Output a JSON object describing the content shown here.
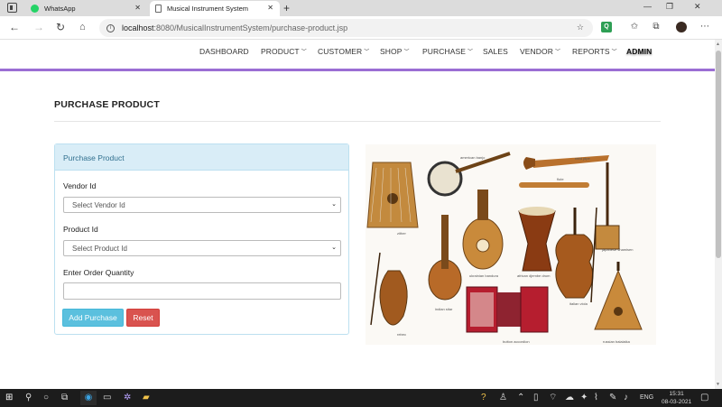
{
  "browser": {
    "tabs": [
      {
        "title": "WhatsApp",
        "active": false,
        "favicon_color": "#25d366"
      },
      {
        "title": "Musical Instrument System",
        "active": true
      }
    ],
    "new_tab": "+",
    "address": {
      "host": "localhost",
      "path": ":8080/MusicalInstrumentSystem/purchase-product.jsp"
    },
    "window_controls": {
      "minimize": "—",
      "restore": "❐",
      "close": "✕"
    }
  },
  "nav": {
    "items": [
      {
        "label": "DASHBOARD",
        "caret": false
      },
      {
        "label": "PRODUCT",
        "caret": true
      },
      {
        "label": "CUSTOMER",
        "caret": true
      },
      {
        "label": "SHOP",
        "caret": true
      },
      {
        "label": "PURCHASE",
        "caret": true
      },
      {
        "label": "SALES",
        "caret": false
      },
      {
        "label": "VENDOR",
        "caret": true
      },
      {
        "label": "REPORTS",
        "caret": true
      }
    ],
    "admin": "ADMIN",
    "accent": "#9b6ed4"
  },
  "page": {
    "title": "PURCHASE PRODUCT"
  },
  "form": {
    "heading": "Purchase Product",
    "vendor_label": "Vendor Id",
    "vendor_placeholder": "Select Vendor Id",
    "product_label": "Product Id",
    "product_placeholder": "Select Product Id",
    "quantity_label": "Enter Order Quantity",
    "quantity_value": "",
    "add_label": "Add Purchase",
    "reset_label": "Reset",
    "colors": {
      "info": "#5bc0de",
      "danger": "#d9534f",
      "panel_head": "#d9edf7"
    }
  },
  "image": {
    "captions": [
      "zither",
      "american banjo",
      "reed pipe",
      "flute",
      "ukrainian bandura",
      "african djembe drum",
      "japanese shamisen",
      "indian sitar",
      "rebec",
      "button accordion",
      "italian viola",
      "russian balalaika"
    ]
  },
  "taskbar": {
    "language": "ENG",
    "time": "15:31",
    "date": "08-03-2021"
  }
}
